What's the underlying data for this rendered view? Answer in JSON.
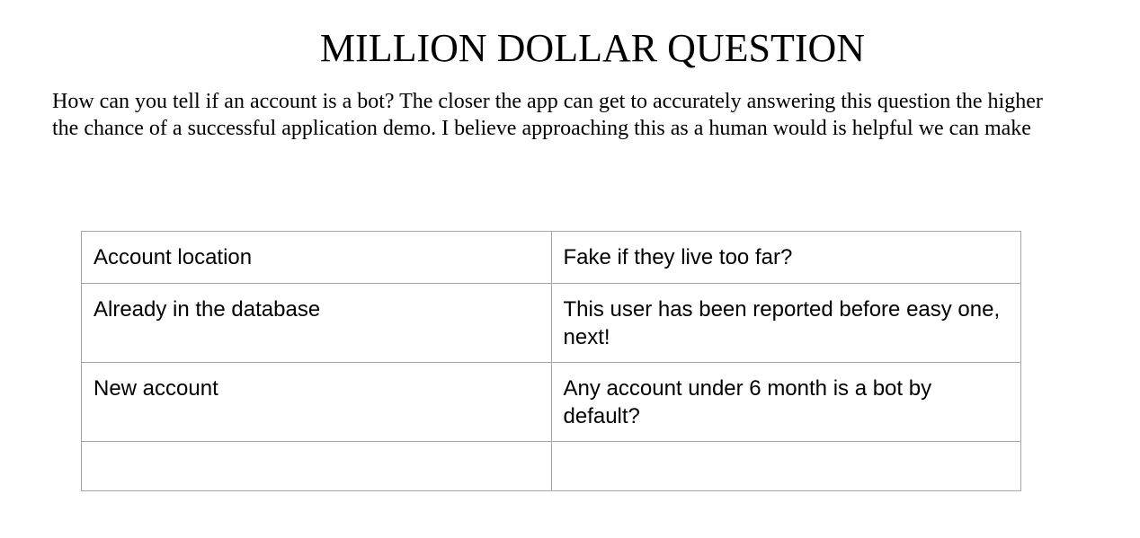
{
  "document": {
    "title": "MILLION DOLLAR QUESTION",
    "intro_lines": [
      "How can you tell if an account is a bot? The closer the app can get to accurately answering this question the higher",
      "the chance of a successful application demo. I believe approaching this as a human would is helpful we can make"
    ],
    "table": {
      "rows": [
        [
          "Account location",
          "Fake if they live too far?"
        ],
        [
          "Already in the database",
          "This user has been reported before easy one, next!"
        ],
        [
          "New account",
          "Any account under 6 month is a bot by default?"
        ],
        [
          "",
          ""
        ]
      ]
    }
  }
}
